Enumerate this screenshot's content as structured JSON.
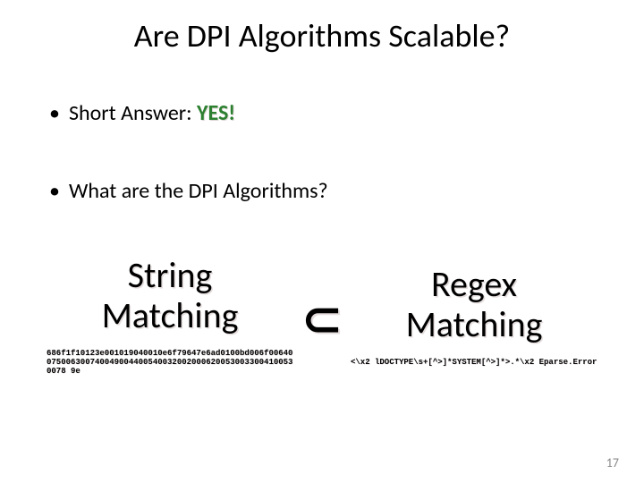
{
  "title": "Are DPI Algorithms Scalable?",
  "bullets": {
    "short_answer_prefix": "Short Answer: ",
    "short_answer_value": "YES!",
    "question": "What are the DPI Algorithms?"
  },
  "left_block": {
    "line1": "String",
    "line2": "Matching",
    "code": "686f1f10123e001019040010e6f79647e6ad0100bd006f006400750063007400490044005400320020006200530033004100530078 9e"
  },
  "subset": "⊂",
  "right_block": {
    "line1": "Regex",
    "line2": "Matching",
    "code": "<\\x2 lDOCTYPE\\s+[^>]*SYSTEM[^>]*>.*\\x2 Eparse.Error"
  },
  "slide_number": "17"
}
